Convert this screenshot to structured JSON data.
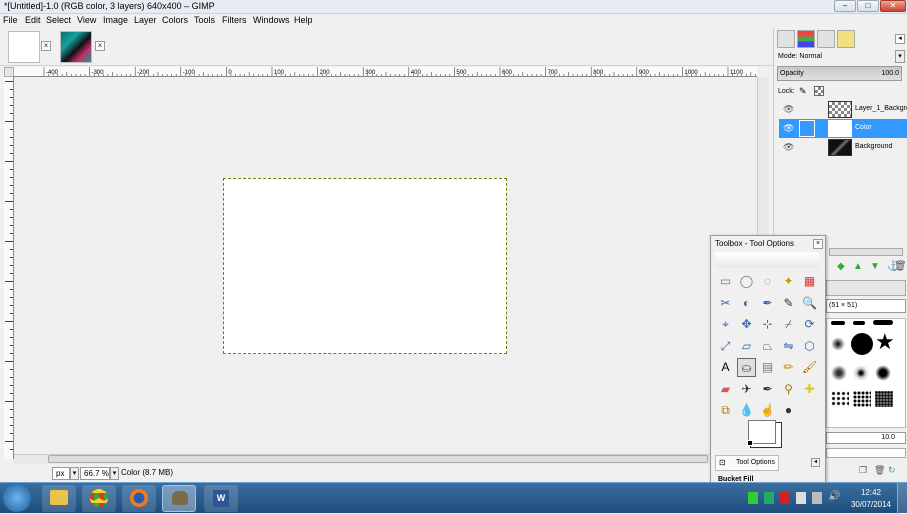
{
  "window": {
    "title": "*[Untitled]-1.0 (RGB color, 3 layers) 640x400 – GIMP"
  },
  "menubar": {
    "items": [
      "File",
      "Edit",
      "Select",
      "View",
      "Image",
      "Layer",
      "Colors",
      "Tools",
      "Filters",
      "Windows",
      "Help"
    ]
  },
  "ruler": {
    "labels": [
      "-400",
      "-300",
      "-200",
      "-100",
      "0",
      "100",
      "200",
      "300",
      "400",
      "500",
      "600",
      "700",
      "800",
      "900",
      "1000",
      "1100"
    ]
  },
  "statusbar": {
    "unit": "px",
    "zoom": "66.7 %",
    "message": "Color (8.7 MB)"
  },
  "layers_panel": {
    "mode_label": "Mode: Normal",
    "opacity_label": "Opacity",
    "opacity_value": "100.0",
    "lock_label": "Lock:",
    "layers": [
      {
        "name": "Layer_1_Backgro",
        "visible": true,
        "selected": false
      },
      {
        "name": "Color",
        "visible": true,
        "selected": true
      },
      {
        "name": "Background",
        "visible": true,
        "selected": false
      }
    ]
  },
  "brushes_panel": {
    "label": "(51 × 51)",
    "spacing_value": "10.0"
  },
  "toolbox": {
    "title": "Toolbox - Tool Options",
    "tool_options_tab": "Tool Options",
    "active_tool": "Bucket Fill"
  },
  "taskbar": {
    "time": "12:42",
    "date": "30/07/2014"
  },
  "colors": {
    "selection": "#3399ff",
    "taskbar": "#1d4d7d"
  }
}
